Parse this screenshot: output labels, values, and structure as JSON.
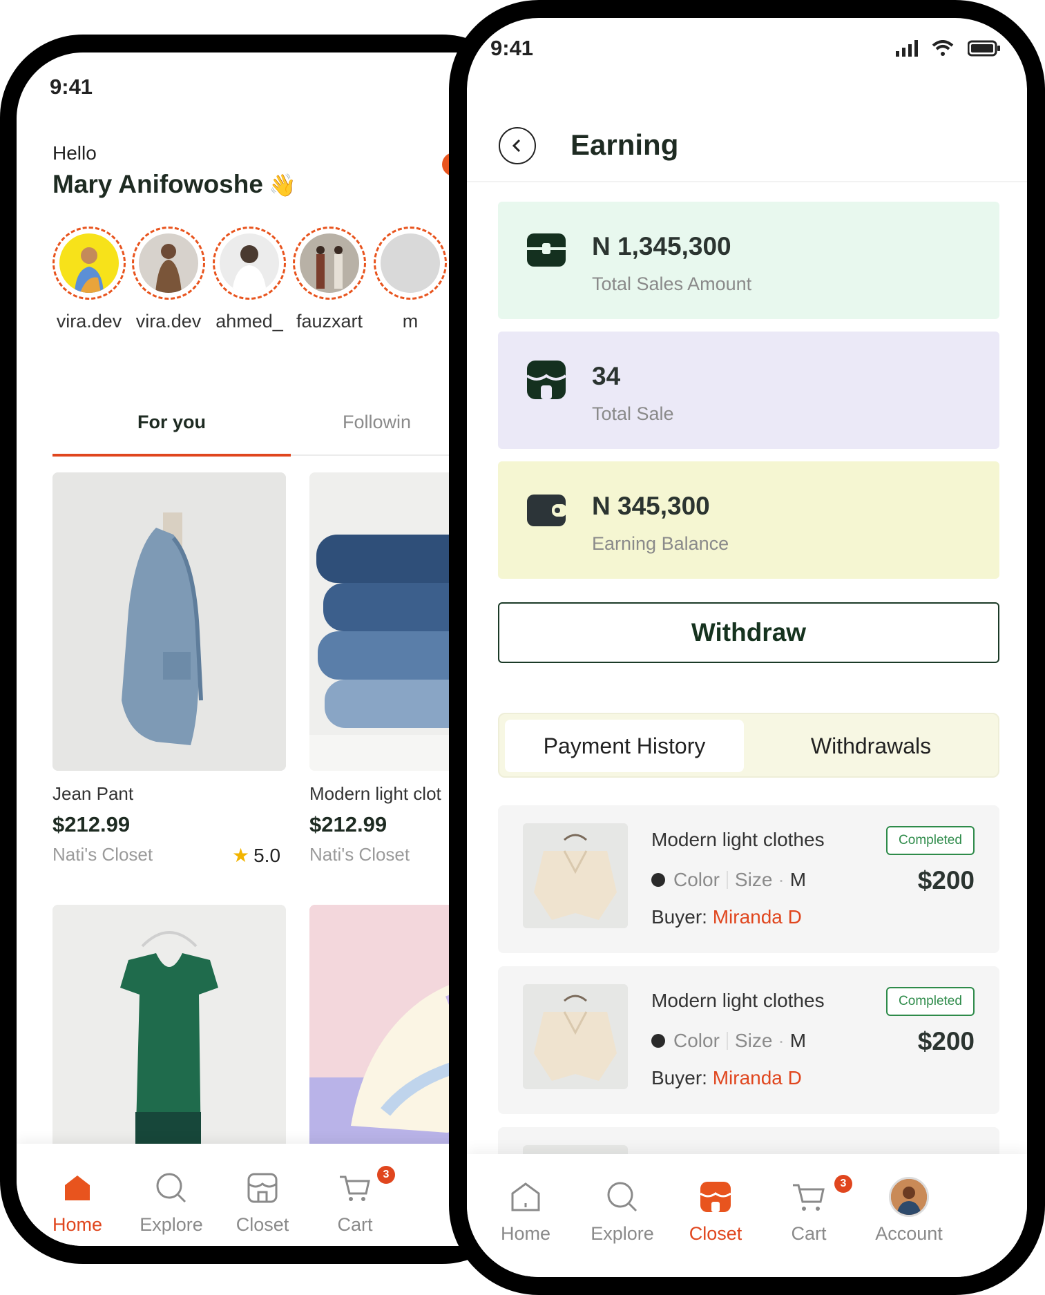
{
  "back_screen": {
    "status_time": "9:41",
    "greeting": "Hello",
    "user_name": "Mary Anifowoshe",
    "wave": "👋",
    "stories": [
      {
        "name": "vira.dev"
      },
      {
        "name": "vira.dev"
      },
      {
        "name": "ahmed_"
      },
      {
        "name": "fauzxart"
      },
      {
        "name": "m"
      }
    ],
    "tabs": [
      "For you",
      "Followin"
    ],
    "products": [
      {
        "title": "Jean Pant",
        "price": "$212.99",
        "shop": "Nati's Closet",
        "rating": "5.0"
      },
      {
        "title": "Modern light clot",
        "price": "$212.99",
        "shop": "Nati's Closet"
      }
    ],
    "nav": [
      "Home",
      "Explore",
      "Closet",
      "Cart"
    ],
    "cart_badge": "3"
  },
  "front_screen": {
    "status_time": "9:41",
    "title": "Earning",
    "stats": [
      {
        "value": "N 1,345,300",
        "label": "Total Sales Amount",
        "color": "#e7f7ee"
      },
      {
        "value": "34",
        "label": "Total Sale",
        "color": "#ebe9f7"
      },
      {
        "value": "N 345,300",
        "label": "Earning Balance",
        "color": "#f5f6d2"
      }
    ],
    "withdraw_label": "Withdraw",
    "segments": [
      "Payment History",
      "Withdrawals"
    ],
    "orders": [
      {
        "title": "Modern light clothes",
        "color_label": "Color",
        "size_label": "Size",
        "size": "M",
        "buyer_label": "Buyer:",
        "buyer": "Miranda D",
        "status": "Completed",
        "price": "$200"
      },
      {
        "title": "Modern light clothes",
        "color_label": "Color",
        "size_label": "Size",
        "size": "M",
        "buyer_label": "Buyer:",
        "buyer": "Miranda D",
        "status": "Completed",
        "price": "$200"
      }
    ],
    "nav": [
      "Home",
      "Explore",
      "Closet",
      "Cart",
      "Account"
    ],
    "cart_badge": "3"
  },
  "colors": {
    "accent": "#e0461e",
    "dark_green": "#16331f",
    "success": "#2e8b4a"
  }
}
